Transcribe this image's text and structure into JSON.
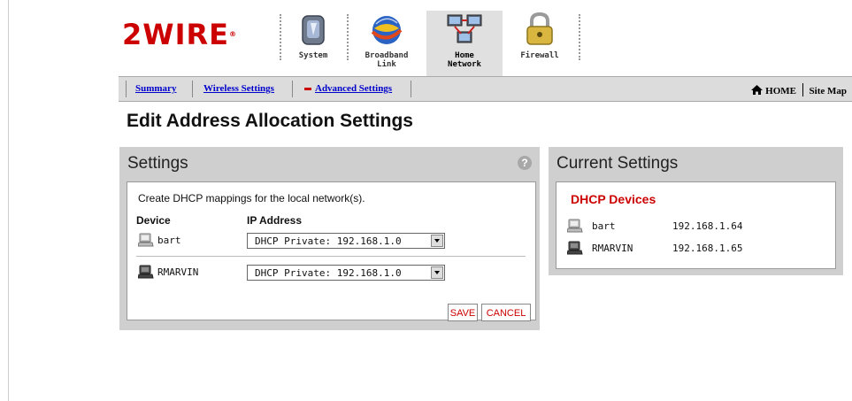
{
  "logo": {
    "text": "2WIRE",
    "mark": "®"
  },
  "top_nav": [
    {
      "label_lines": [
        "System"
      ],
      "icon": "system-icon",
      "active": false
    },
    {
      "label_lines": [
        "Broadband",
        "Link"
      ],
      "icon": "broadband-globe-icon",
      "active": false
    },
    {
      "label_lines": [
        "Home",
        "Network"
      ],
      "icon": "home-network-icon",
      "active": true
    },
    {
      "label_lines": [
        "Firewall"
      ],
      "icon": "firewall-lock-icon",
      "active": false
    }
  ],
  "sub_nav": {
    "summary": "Summary",
    "wireless": "Wireless Settings",
    "advanced": "Advanced Settings",
    "home": "HOME",
    "sitemap": "Site Map"
  },
  "page_title": "Edit Address Allocation Settings",
  "settings": {
    "title": "Settings",
    "help": "?",
    "intro": "Create DHCP mappings for the local network(s).",
    "col_device": "Device",
    "col_ip": "IP Address",
    "rows": [
      {
        "device": "bart",
        "ip_selected": "DHCP Private: 192.168.1.0",
        "icon": "computer-icon"
      },
      {
        "device": "RMARVIN",
        "ip_selected": "DHCP Private: 192.168.1.0",
        "icon": "computer-icon"
      }
    ],
    "save": "SAVE",
    "cancel": "CANCEL"
  },
  "current": {
    "title": "Current Settings",
    "dhcp_title": "DHCP Devices",
    "devices": [
      {
        "name": "bart",
        "ip": "192.168.1.64"
      },
      {
        "name": "RMARVIN",
        "ip": "192.168.1.65"
      }
    ]
  },
  "colors": {
    "accent_red": "#cc0000",
    "link_blue": "#0000cc",
    "panel_gray": "#cfcfcf"
  }
}
